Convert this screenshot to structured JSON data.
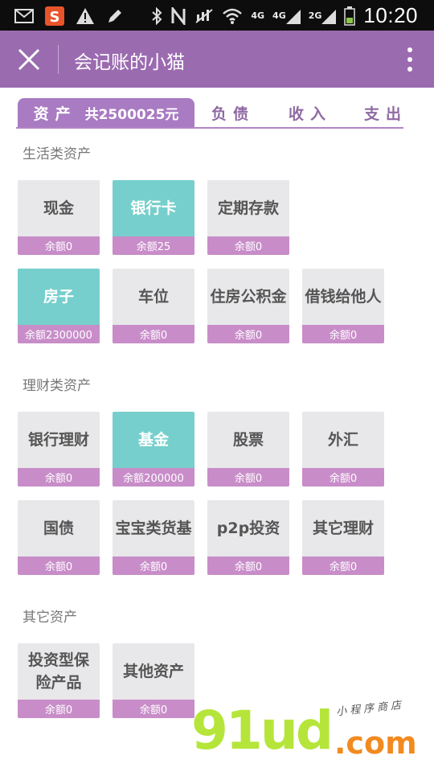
{
  "status_bar": {
    "time": "10:20",
    "net_4g_a": "4G",
    "net_4g_b": "4G",
    "net_2g": "2G",
    "icons": [
      "mail-icon",
      "sogou-icon",
      "warning-icon",
      "pen-icon",
      "bluetooth-icon",
      "nfc-icon",
      "mute-icon",
      "wifi-icon",
      "signal-icon",
      "battery-icon"
    ]
  },
  "header": {
    "title": "会记账的小猫",
    "accent_color": "#9b6bb0"
  },
  "tabs": {
    "assets_label": "资产",
    "assets_total": "共2500025元",
    "liabilities_label": "负债",
    "income_label": "收入",
    "expense_label": "支出"
  },
  "sections": [
    {
      "title": "生活类资产",
      "items": [
        {
          "name": "现金",
          "balance": "余额0",
          "highlight": false
        },
        {
          "name": "银行卡",
          "balance": "余额25",
          "highlight": true
        },
        {
          "name": "定期存款",
          "balance": "余额0",
          "highlight": false
        },
        {
          "name": "房子",
          "balance": "余额2300000",
          "highlight": true
        },
        {
          "name": "车位",
          "balance": "余额0",
          "highlight": false
        },
        {
          "name": "住房公积金",
          "balance": "余额0",
          "highlight": false
        },
        {
          "name": "借钱给他人",
          "balance": "余额0",
          "highlight": false
        }
      ]
    },
    {
      "title": "理财类资产",
      "items": [
        {
          "name": "银行理财",
          "balance": "余额0",
          "highlight": false
        },
        {
          "name": "基金",
          "balance": "余额200000",
          "highlight": true
        },
        {
          "name": "股票",
          "balance": "余额0",
          "highlight": false
        },
        {
          "name": "外汇",
          "balance": "余额0",
          "highlight": false
        },
        {
          "name": "国债",
          "balance": "余额0",
          "highlight": false
        },
        {
          "name": "宝宝类货基",
          "balance": "余额0",
          "highlight": false
        },
        {
          "name": "p2p投资",
          "balance": "余额0",
          "highlight": false
        },
        {
          "name": "其它理财",
          "balance": "余额0",
          "highlight": false
        }
      ]
    },
    {
      "title": "其它资产",
      "items": [
        {
          "name": "投资型保险产品",
          "balance": "余额0",
          "highlight": false
        },
        {
          "name": "其他资产",
          "balance": "余额0",
          "highlight": false
        }
      ]
    }
  ],
  "watermark": {
    "brand": "91ud",
    "tld": ".com",
    "tagline": "小程序商店"
  }
}
